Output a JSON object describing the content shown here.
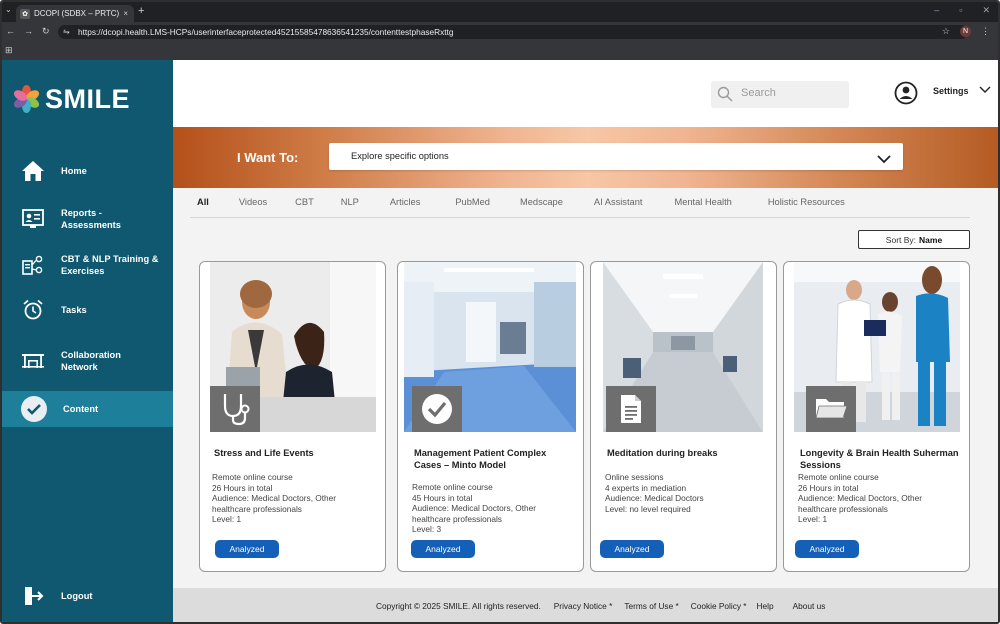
{
  "browser": {
    "tab_title": "DCOPI (SDBX – PRTC)",
    "tab_close": "×",
    "new_tab": "+",
    "url": "https://dcopi.health.LMS-HCPs/userinterfaceprotected452155854786365412​35/contenttestphaseRxttg",
    "profile_initial": "N"
  },
  "sidebar": {
    "logo_text": "SMILE",
    "items": [
      {
        "label": "Home",
        "icon": "home-icon"
      },
      {
        "label": "Reports -\nAssessments",
        "icon": "reports-icon"
      },
      {
        "label": "CBT & NLP Training &\nExercises",
        "icon": "training-icon"
      },
      {
        "label": "Tasks",
        "icon": "alarm-clock-icon"
      },
      {
        "label": "Collaboration\nNetwork",
        "icon": "network-icon"
      },
      {
        "label": "Content",
        "icon": "check-circle-icon"
      },
      {
        "label": "Logout",
        "icon": "logout-icon"
      }
    ],
    "active_index": 5
  },
  "header": {
    "search_placeholder": "Search",
    "settings_label": "Settings"
  },
  "banner": {
    "label": "I Want To:",
    "dropdown_value": "Explore specific options"
  },
  "filters": {
    "tabs": [
      "All",
      "Videos",
      "CBT",
      "NLP",
      "Articles",
      "PubMed",
      "Medscape",
      "AI Assistant",
      "Mental Health",
      "Holistic Resources"
    ],
    "active": "All",
    "sort_prefix": "Sort By:",
    "sort_value": "Name"
  },
  "cards": [
    {
      "title": "Stress and Life Events",
      "lines": [
        "Remote online course",
        "26 Hours in total",
        "Audience: Medical Doctors, Other",
        "healthcare professionals",
        "Level: 1"
      ],
      "button": "Analyzed",
      "badge_icon": "stethoscope-icon"
    },
    {
      "title": "Management Patient Complex Cases – Minto Model",
      "lines": [
        "Remote online course",
        "45 Hours in total",
        "Audience: Medical Doctors, Other",
        "healthcare professionals",
        "Level: 3"
      ],
      "button": "Analyzed",
      "badge_icon": "checkmark-icon"
    },
    {
      "title": "Meditation during breaks",
      "lines": [
        "Online sessions",
        "4 experts in mediation",
        "Audience: Medical Doctors",
        "Level: no level required"
      ],
      "button": "Analyzed",
      "badge_icon": "document-icon"
    },
    {
      "title": "Longevity & Brain Health Suherman Sessions",
      "lines": [
        "Remote online course",
        "26 Hours in total",
        "Audience: Medical Doctors, Other",
        "healthcare professionals",
        "Level: 1"
      ],
      "button": "Analyzed",
      "badge_icon": "folder-icon"
    }
  ],
  "footer": {
    "copyright": "Copyright © 2025 SMILE. All rights reserved.",
    "privacy": "Privacy Notice *",
    "terms": "Terms of Use *",
    "cookie": "Cookie Policy *",
    "help": "Help",
    "about": "About us"
  },
  "colors": {
    "sidebar": "#0f5870",
    "sidebar_active": "#1e7f9a",
    "button": "#1460b8",
    "banner_orange": "#b4501a"
  }
}
